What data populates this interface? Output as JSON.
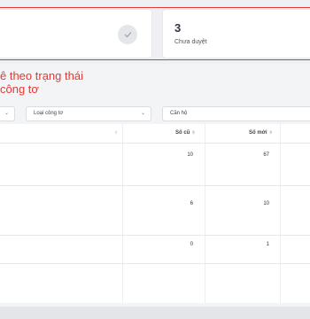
{
  "stats": {
    "pending_value": "3",
    "pending_label": "Chưa duyệt"
  },
  "annotation": {
    "line1": "ê theo trạng thái",
    "line2": "công tơ"
  },
  "filters": {
    "first_value": "",
    "meter_type_placeholder": "Loại công tơ",
    "apartment_placeholder": "Căn hộ"
  },
  "table": {
    "headers": {
      "old_reading": "Số cũ",
      "new_reading": "Số mới"
    },
    "rows": [
      {
        "old": "10",
        "new": "67"
      },
      {
        "old": "6",
        "new": "10"
      },
      {
        "old": "0",
        "new": "1"
      }
    ]
  },
  "colors": {
    "annotation_red": "#e53935",
    "background": "#f3f4f6",
    "card": "#ffffff"
  },
  "icons": {
    "check": "check-icon",
    "chevron": "chevron-down-icon",
    "sort": "sort-icon"
  }
}
